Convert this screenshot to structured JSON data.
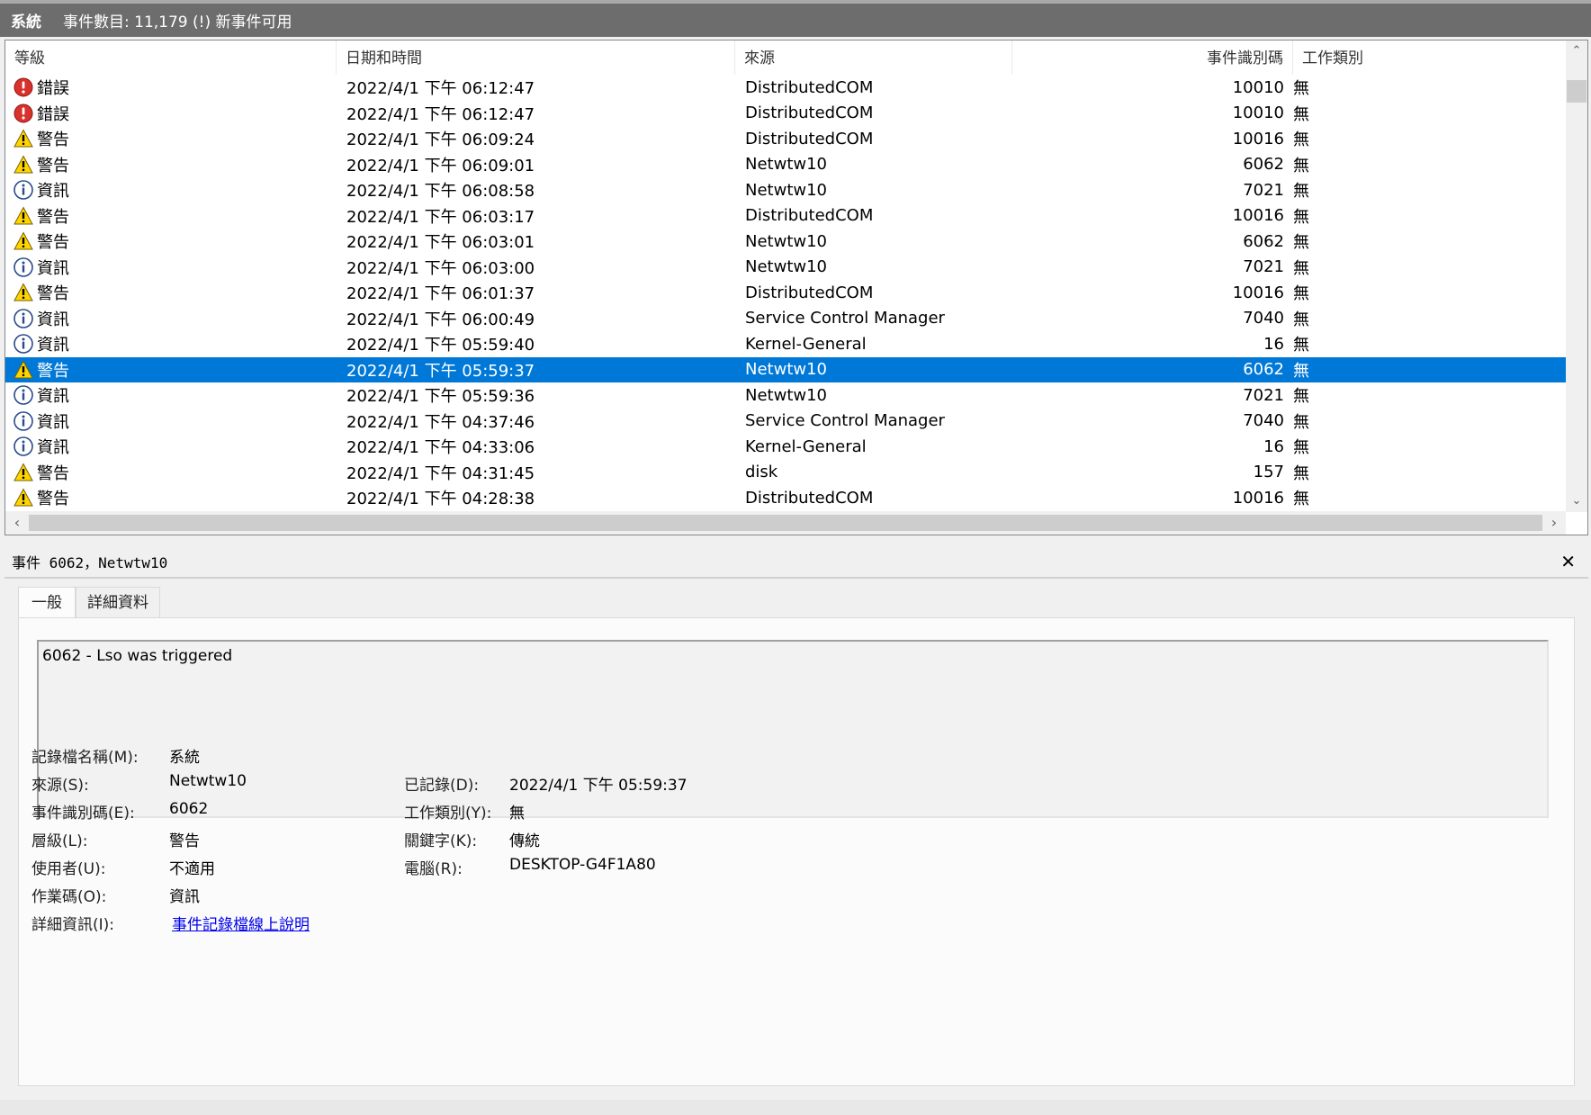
{
  "titlebar": {
    "log_name": "系統",
    "event_count": "事件數目: 11,179 (!) 新事件可用"
  },
  "columns": {
    "level": "等級",
    "date": "日期和時間",
    "source": "來源",
    "event_id": "事件識別碼",
    "task": "工作類別"
  },
  "events": [
    {
      "level": "錯誤",
      "type": "error",
      "date": "2022/4/1 下午 06:12:47",
      "source": "DistributedCOM",
      "event_id": "10010",
      "task": "無"
    },
    {
      "level": "錯誤",
      "type": "error",
      "date": "2022/4/1 下午 06:12:47",
      "source": "DistributedCOM",
      "event_id": "10010",
      "task": "無"
    },
    {
      "level": "警告",
      "type": "warning",
      "date": "2022/4/1 下午 06:09:24",
      "source": "DistributedCOM",
      "event_id": "10016",
      "task": "無"
    },
    {
      "level": "警告",
      "type": "warning",
      "date": "2022/4/1 下午 06:09:01",
      "source": "Netwtw10",
      "event_id": "6062",
      "task": "無"
    },
    {
      "level": "資訊",
      "type": "info",
      "date": "2022/4/1 下午 06:08:58",
      "source": "Netwtw10",
      "event_id": "7021",
      "task": "無"
    },
    {
      "level": "警告",
      "type": "warning",
      "date": "2022/4/1 下午 06:03:17",
      "source": "DistributedCOM",
      "event_id": "10016",
      "task": "無"
    },
    {
      "level": "警告",
      "type": "warning",
      "date": "2022/4/1 下午 06:03:01",
      "source": "Netwtw10",
      "event_id": "6062",
      "task": "無"
    },
    {
      "level": "資訊",
      "type": "info",
      "date": "2022/4/1 下午 06:03:00",
      "source": "Netwtw10",
      "event_id": "7021",
      "task": "無"
    },
    {
      "level": "警告",
      "type": "warning",
      "date": "2022/4/1 下午 06:01:37",
      "source": "DistributedCOM",
      "event_id": "10016",
      "task": "無"
    },
    {
      "level": "資訊",
      "type": "info",
      "date": "2022/4/1 下午 06:00:49",
      "source": "Service Control Manager",
      "event_id": "7040",
      "task": "無"
    },
    {
      "level": "資訊",
      "type": "info",
      "date": "2022/4/1 下午 05:59:40",
      "source": "Kernel-General",
      "event_id": "16",
      "task": "無"
    },
    {
      "level": "警告",
      "type": "warning",
      "date": "2022/4/1 下午 05:59:37",
      "source": "Netwtw10",
      "event_id": "6062",
      "task": "無",
      "selected": true
    },
    {
      "level": "資訊",
      "type": "info",
      "date": "2022/4/1 下午 05:59:36",
      "source": "Netwtw10",
      "event_id": "7021",
      "task": "無"
    },
    {
      "level": "資訊",
      "type": "info",
      "date": "2022/4/1 下午 04:37:46",
      "source": "Service Control Manager",
      "event_id": "7040",
      "task": "無"
    },
    {
      "level": "資訊",
      "type": "info",
      "date": "2022/4/1 下午 04:33:06",
      "source": "Kernel-General",
      "event_id": "16",
      "task": "無"
    },
    {
      "level": "警告",
      "type": "warning",
      "date": "2022/4/1 下午 04:31:45",
      "source": "disk",
      "event_id": "157",
      "task": "無"
    },
    {
      "level": "警告",
      "type": "warning",
      "date": "2022/4/1 下午 04:28:38",
      "source": "DistributedCOM",
      "event_id": "10016",
      "task": "無"
    }
  ],
  "detail": {
    "title": "事件 6062，Netwtw10",
    "tabs": [
      "一般",
      "詳細資料"
    ],
    "description": "6062 - Lso was triggered",
    "props": {
      "log_name_label": "記錄檔名稱(M):",
      "log_name": "系統",
      "source_label": "來源(S):",
      "source": "Netwtw10",
      "logged_label": "已記錄(D):",
      "logged": "2022/4/1 下午 05:59:37",
      "event_id_label": "事件識別碼(E):",
      "event_id": "6062",
      "task_label": "工作類別(Y):",
      "task": "無",
      "level_label": "層級(L):",
      "level": "警告",
      "keywords_label": "關鍵字(K):",
      "keywords": "傳統",
      "user_label": "使用者(U):",
      "user": "不適用",
      "computer_label": "電腦(R):",
      "computer": "DESKTOP-G4F1A80",
      "opcode_label": "作業碼(O):",
      "opcode": "資訊",
      "more_info_label": "詳細資訊(I):",
      "more_info_link": "事件記錄檔線上說明"
    }
  },
  "colors": {
    "selection": "#0078d7",
    "error_icon": "#d9312b",
    "warning_icon": "#ffd500",
    "info_icon": "#2a4a8c"
  }
}
